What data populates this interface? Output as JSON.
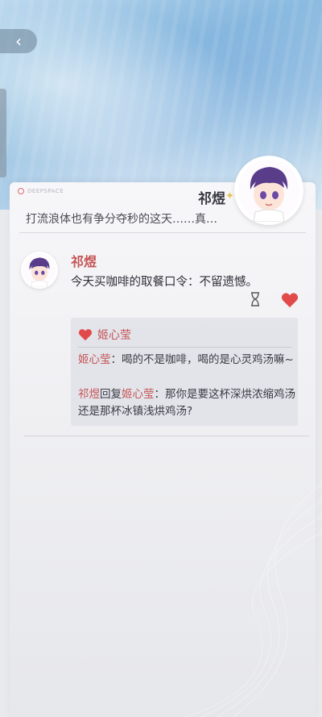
{
  "post": {
    "header_name": "祁煜",
    "title": "打流浪体也有争分夺秒的这天……真…",
    "author": "祁煜",
    "message": "今天买咖啡的取餐口令：不留遗憾。"
  },
  "reply": {
    "liker_name": "姬心莹",
    "comment": {
      "author": "姬心莹",
      "sep": "：",
      "text": "喝的不是咖啡，喝的是心灵鸡汤嘛~"
    },
    "response": {
      "author": "祁煜",
      "verb": "回复",
      "target": "姬心莹",
      "sep": "：",
      "text": "那你是要这杯深烘浓缩鸡汤还是那杯冰镇浅烘鸡汤?"
    }
  },
  "icons": [
    "back-icon",
    "hourglass-icon",
    "heart-icon"
  ],
  "colors": {
    "accent": "#c45454",
    "heart": "#e24a4a"
  }
}
